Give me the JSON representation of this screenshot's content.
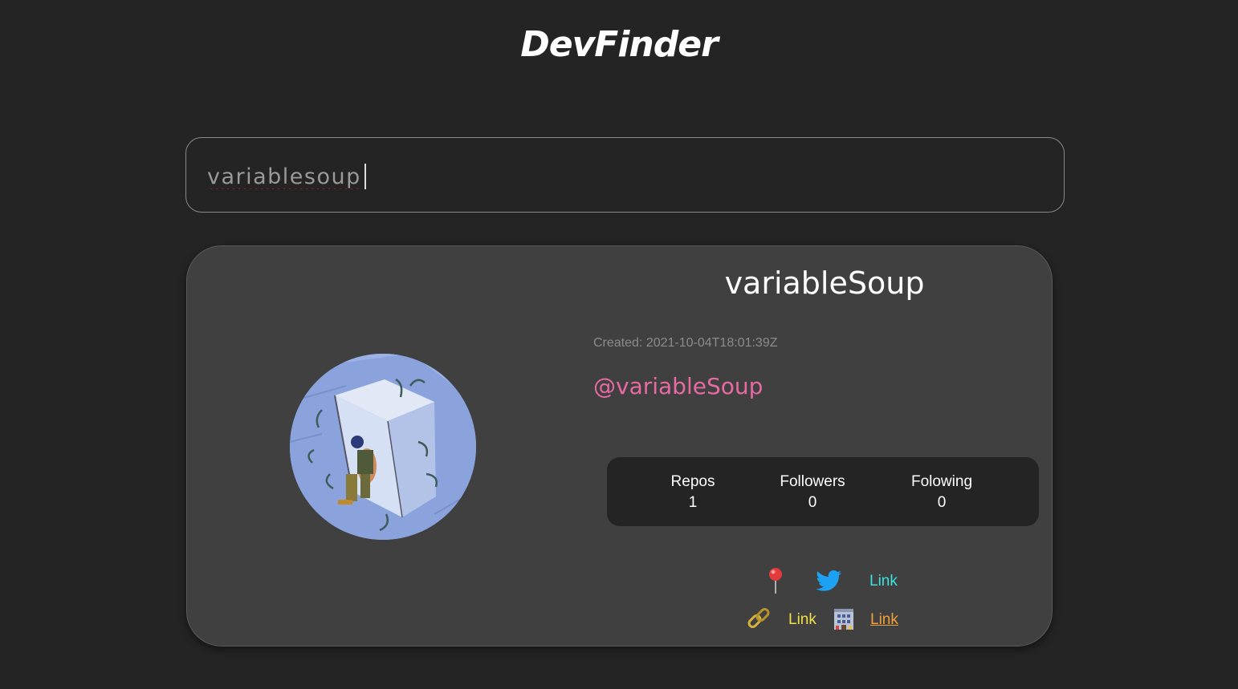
{
  "app": {
    "title": "DevFinder"
  },
  "search": {
    "value": "variablesoup",
    "placeholder": ""
  },
  "profile": {
    "name": "variableSoup",
    "created_label": "Created: ",
    "created_value": "2021-10-04T18:01:39Z",
    "handle": "@variableSoup",
    "stats": [
      {
        "label": "Repos",
        "value": "1"
      },
      {
        "label": "Followers",
        "value": "0"
      },
      {
        "label": "Folowing",
        "value": "0"
      }
    ],
    "links": {
      "location_icon": "pushpin-icon",
      "twitter_icon": "twitter-bird-icon",
      "twitter_label": "Link",
      "blog_icon": "chain-link-icon",
      "blog_label": "Link",
      "company_icon": "office-building-icon",
      "company_label": "Link"
    }
  },
  "colors": {
    "background": "#242424",
    "card": "#404040",
    "handle": "#e86aa3",
    "twitter_link": "#3fe0e0",
    "blog_link": "#f2e04a",
    "company_link": "#f0a03a"
  }
}
